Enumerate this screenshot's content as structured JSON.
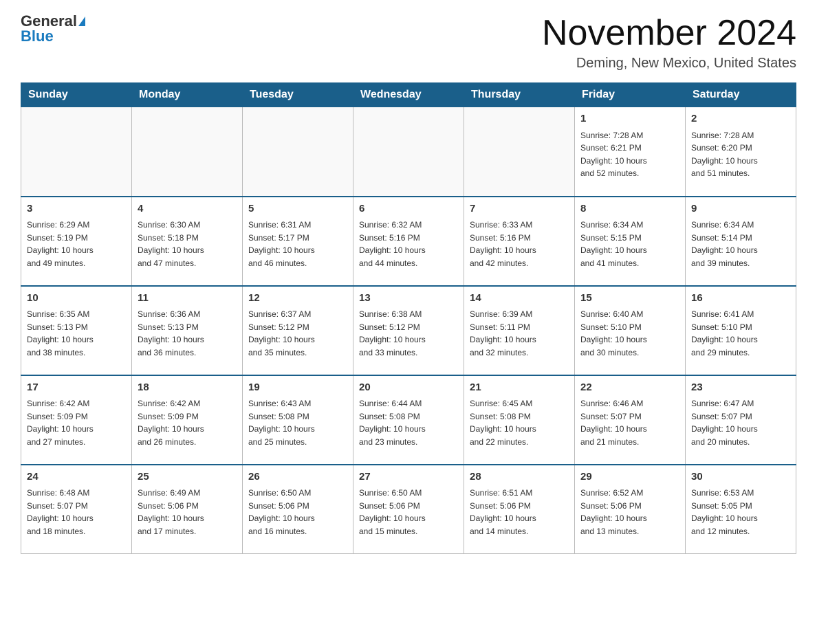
{
  "header": {
    "logo_general": "General",
    "logo_blue": "Blue",
    "title": "November 2024",
    "location": "Deming, New Mexico, United States"
  },
  "days_of_week": [
    "Sunday",
    "Monday",
    "Tuesday",
    "Wednesday",
    "Thursday",
    "Friday",
    "Saturday"
  ],
  "weeks": [
    [
      {
        "day": "",
        "info": ""
      },
      {
        "day": "",
        "info": ""
      },
      {
        "day": "",
        "info": ""
      },
      {
        "day": "",
        "info": ""
      },
      {
        "day": "",
        "info": ""
      },
      {
        "day": "1",
        "info": "Sunrise: 7:28 AM\nSunset: 6:21 PM\nDaylight: 10 hours\nand 52 minutes."
      },
      {
        "day": "2",
        "info": "Sunrise: 7:28 AM\nSunset: 6:20 PM\nDaylight: 10 hours\nand 51 minutes."
      }
    ],
    [
      {
        "day": "3",
        "info": "Sunrise: 6:29 AM\nSunset: 5:19 PM\nDaylight: 10 hours\nand 49 minutes."
      },
      {
        "day": "4",
        "info": "Sunrise: 6:30 AM\nSunset: 5:18 PM\nDaylight: 10 hours\nand 47 minutes."
      },
      {
        "day": "5",
        "info": "Sunrise: 6:31 AM\nSunset: 5:17 PM\nDaylight: 10 hours\nand 46 minutes."
      },
      {
        "day": "6",
        "info": "Sunrise: 6:32 AM\nSunset: 5:16 PM\nDaylight: 10 hours\nand 44 minutes."
      },
      {
        "day": "7",
        "info": "Sunrise: 6:33 AM\nSunset: 5:16 PM\nDaylight: 10 hours\nand 42 minutes."
      },
      {
        "day": "8",
        "info": "Sunrise: 6:34 AM\nSunset: 5:15 PM\nDaylight: 10 hours\nand 41 minutes."
      },
      {
        "day": "9",
        "info": "Sunrise: 6:34 AM\nSunset: 5:14 PM\nDaylight: 10 hours\nand 39 minutes."
      }
    ],
    [
      {
        "day": "10",
        "info": "Sunrise: 6:35 AM\nSunset: 5:13 PM\nDaylight: 10 hours\nand 38 minutes."
      },
      {
        "day": "11",
        "info": "Sunrise: 6:36 AM\nSunset: 5:13 PM\nDaylight: 10 hours\nand 36 minutes."
      },
      {
        "day": "12",
        "info": "Sunrise: 6:37 AM\nSunset: 5:12 PM\nDaylight: 10 hours\nand 35 minutes."
      },
      {
        "day": "13",
        "info": "Sunrise: 6:38 AM\nSunset: 5:12 PM\nDaylight: 10 hours\nand 33 minutes."
      },
      {
        "day": "14",
        "info": "Sunrise: 6:39 AM\nSunset: 5:11 PM\nDaylight: 10 hours\nand 32 minutes."
      },
      {
        "day": "15",
        "info": "Sunrise: 6:40 AM\nSunset: 5:10 PM\nDaylight: 10 hours\nand 30 minutes."
      },
      {
        "day": "16",
        "info": "Sunrise: 6:41 AM\nSunset: 5:10 PM\nDaylight: 10 hours\nand 29 minutes."
      }
    ],
    [
      {
        "day": "17",
        "info": "Sunrise: 6:42 AM\nSunset: 5:09 PM\nDaylight: 10 hours\nand 27 minutes."
      },
      {
        "day": "18",
        "info": "Sunrise: 6:42 AM\nSunset: 5:09 PM\nDaylight: 10 hours\nand 26 minutes."
      },
      {
        "day": "19",
        "info": "Sunrise: 6:43 AM\nSunset: 5:08 PM\nDaylight: 10 hours\nand 25 minutes."
      },
      {
        "day": "20",
        "info": "Sunrise: 6:44 AM\nSunset: 5:08 PM\nDaylight: 10 hours\nand 23 minutes."
      },
      {
        "day": "21",
        "info": "Sunrise: 6:45 AM\nSunset: 5:08 PM\nDaylight: 10 hours\nand 22 minutes."
      },
      {
        "day": "22",
        "info": "Sunrise: 6:46 AM\nSunset: 5:07 PM\nDaylight: 10 hours\nand 21 minutes."
      },
      {
        "day": "23",
        "info": "Sunrise: 6:47 AM\nSunset: 5:07 PM\nDaylight: 10 hours\nand 20 minutes."
      }
    ],
    [
      {
        "day": "24",
        "info": "Sunrise: 6:48 AM\nSunset: 5:07 PM\nDaylight: 10 hours\nand 18 minutes."
      },
      {
        "day": "25",
        "info": "Sunrise: 6:49 AM\nSunset: 5:06 PM\nDaylight: 10 hours\nand 17 minutes."
      },
      {
        "day": "26",
        "info": "Sunrise: 6:50 AM\nSunset: 5:06 PM\nDaylight: 10 hours\nand 16 minutes."
      },
      {
        "day": "27",
        "info": "Sunrise: 6:50 AM\nSunset: 5:06 PM\nDaylight: 10 hours\nand 15 minutes."
      },
      {
        "day": "28",
        "info": "Sunrise: 6:51 AM\nSunset: 5:06 PM\nDaylight: 10 hours\nand 14 minutes."
      },
      {
        "day": "29",
        "info": "Sunrise: 6:52 AM\nSunset: 5:06 PM\nDaylight: 10 hours\nand 13 minutes."
      },
      {
        "day": "30",
        "info": "Sunrise: 6:53 AM\nSunset: 5:05 PM\nDaylight: 10 hours\nand 12 minutes."
      }
    ]
  ]
}
